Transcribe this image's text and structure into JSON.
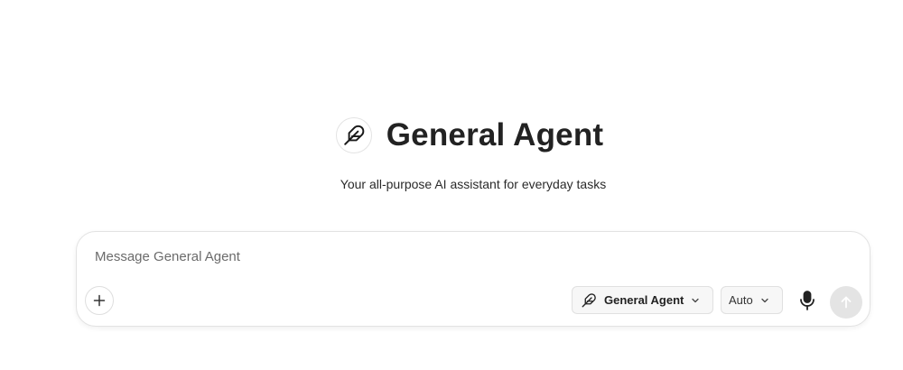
{
  "header": {
    "agent_name": "General Agent",
    "subtitle": "Your all-purpose AI assistant for everyday tasks",
    "avatar_icon": "feather-icon"
  },
  "composer": {
    "placeholder": "Message General Agent",
    "value": "",
    "add_icon": "plus-icon",
    "agent_selector": {
      "icon": "feather-icon",
      "label": "General Agent"
    },
    "mode_selector": {
      "label": "Auto"
    },
    "mic_icon": "microphone-icon",
    "send_icon": "arrow-up-icon"
  },
  "colors": {
    "send_button_disabled": "#e4e4e4",
    "border": "#e2e2e2",
    "text": "#222222"
  }
}
